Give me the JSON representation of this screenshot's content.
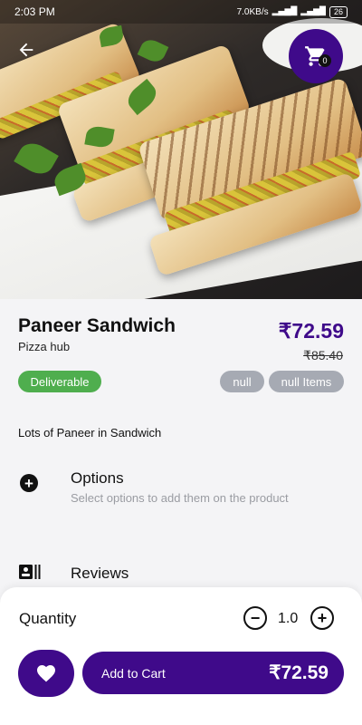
{
  "status_bar": {
    "time": "2:03 PM",
    "network_speed": "7.0KB/s",
    "battery": "26"
  },
  "hero": {
    "back_icon": "arrow-left-icon",
    "cart_icon": "shopping-cart-icon",
    "cart_count": "0"
  },
  "product": {
    "name": "Paneer Sandwich",
    "shop": "Pizza hub",
    "price": "₹72.59",
    "old_price": "₹85.40",
    "chip_deliverable": "Deliverable",
    "chip_null": "null",
    "chip_null_items": "null Items",
    "description": "Lots of Paneer in Sandwich"
  },
  "options": {
    "icon": "plus-circle-icon",
    "title": "Options",
    "subtitle": "Select options to add them on the product"
  },
  "reviews": {
    "icon": "reviews-icon",
    "title": "Reviews"
  },
  "bottom": {
    "quantity_label": "Quantity",
    "quantity_value": "1.0",
    "minus_symbol": "−",
    "plus_symbol": "+",
    "favorite_icon": "heart-icon",
    "add_to_cart_label": "Add to Cart",
    "add_to_cart_price": "₹72.59"
  },
  "colors": {
    "accent": "#3f0a8a",
    "deliverable": "#4fae4e",
    "chip_gray": "#a6aab3"
  }
}
